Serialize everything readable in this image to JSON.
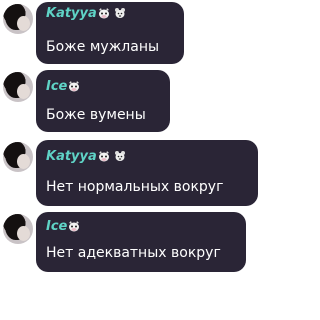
{
  "messages": [
    {
      "author": "Katyya",
      "text": "Боже мужланы",
      "badges": [
        "cow-icon",
        "bear-icon"
      ]
    },
    {
      "author": "Ice",
      "text": "Боже вумены",
      "badges": [
        "cow-icon"
      ]
    },
    {
      "author": "Katyya",
      "text": "Нет нормальных вокруг",
      "badges": [
        "cow-icon",
        "bear-icon"
      ]
    },
    {
      "author": "Ice",
      "text": "Нет адекватных вокруг",
      "badges": [
        "cow-icon"
      ]
    }
  ],
  "colors": {
    "bubble": "#2a2536",
    "name": "#5fd3c6",
    "text": "#ffffff"
  }
}
